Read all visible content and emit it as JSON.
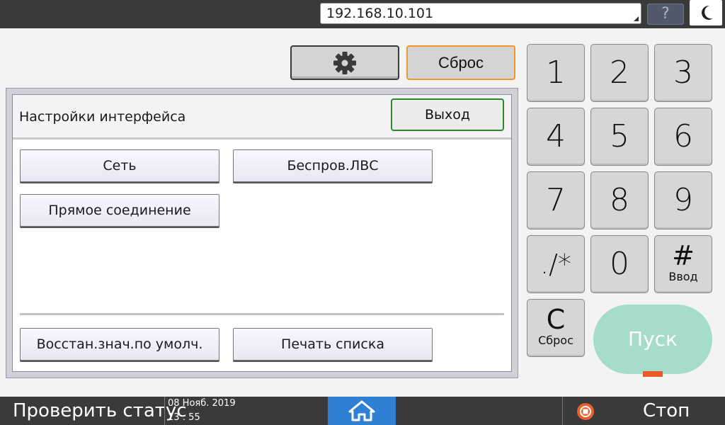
{
  "topbar": {
    "ip_address": "192.168.10.101",
    "help_label": "?"
  },
  "actions": {
    "reset_label": "Сброс"
  },
  "panel": {
    "title": "Настройки интерфейса",
    "exit_label": "Выход",
    "options": [
      {
        "label": "Сеть"
      },
      {
        "label": "Беспров.ЛВС"
      },
      {
        "label": "Прямое соединение"
      }
    ],
    "footer_buttons": [
      {
        "label": "Восстан.знач.по умолч."
      },
      {
        "label": "Печать списка"
      }
    ]
  },
  "keypad": {
    "keys": [
      "1",
      "2",
      "3",
      "4",
      "5",
      "6",
      "7",
      "8",
      "9",
      "./*",
      "0"
    ],
    "hash_symbol": "#",
    "hash_sub": "Ввод",
    "clear_symbol": "C",
    "clear_sub": "Сброс",
    "start_label": "Пуск",
    "start_color": "#a6dccc"
  },
  "bottombar": {
    "status_label": "Проверить статус",
    "date": "08 Нояб. 2019",
    "time": "13 : 55",
    "stop_label": "Стоп",
    "home_color": "#2f7fd4"
  }
}
